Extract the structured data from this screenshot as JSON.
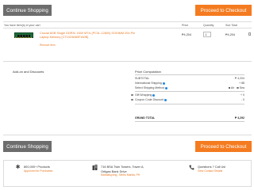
{
  "buttons": {
    "continue_shopping": "Continue Shopping",
    "proceed_checkout": "Proceed to Checkout"
  },
  "cart": {
    "header_note": "You have item(s) in your cart",
    "columns": {
      "price": "Price",
      "quantity": "Quantity",
      "subtotal": "Sub Total"
    },
    "item": {
      "title": "Crucial 8GB Single DDR3L 1600 MT/s (PC3L-12800) SODIMM 204-Pin Laptop Memory (CT102464BF160B)",
      "remove": "Remove Item",
      "price": "₱4,204",
      "quantity": "1",
      "subtotal": "₱4,204"
    }
  },
  "addons": {
    "title": "Add-on and Discounts"
  },
  "price_computation": {
    "title": "Price Computation",
    "subtotal_label": "SUBTOTAL",
    "subtotal_value": "₱ 4,204",
    "intl_shipping_label": "International Shipping",
    "intl_shipping_value": "+ 88",
    "shipping_method_label": "Select Shipping Method",
    "shipping_option_a": "Air",
    "shipping_option_b": "Sea",
    "gift_wrapping_label": "Gift Wrapping",
    "gift_wrapping_value": "+ 0",
    "coupon_label": "Coupon Code Discount",
    "coupon_value": "- 0",
    "grand_total_label": "GRAND TOTAL",
    "grand_total_value": "₱ 4,292"
  },
  "footer": {
    "products_line1": "800,000+ Products",
    "products_sub": "Approved for Purchases",
    "address_line1": "716 BSA Twin Towers, Tower A,",
    "address_line2": "Ortigas Bank Drive",
    "address_sub": "Mandaluyong , Metro Manila, PH",
    "contact_line1": "Questions ? Call Us!",
    "contact_sub": "View Contact Details"
  },
  "colors": {
    "accent": "#f47b20",
    "button_gray": "#6d6d6d"
  },
  "icons": {
    "products": "asterisk-icon",
    "address": "building-icon",
    "contact": "phone-icon"
  }
}
